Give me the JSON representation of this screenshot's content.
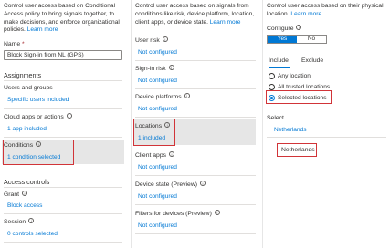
{
  "pane1": {
    "description": "Control user access based on Conditional Access policy to bring signals together, to make decisions, and enforce organizational policies.",
    "learn_more": "Learn more",
    "name_label": "Name",
    "required_mark": "*",
    "name_value": "Block Sign-in from NL (GPS)",
    "assignments_heading": "Assignments",
    "users_label": "Users and groups",
    "users_value": "Specific users included",
    "apps_label": "Cloud apps or actions",
    "apps_value": "1 app included",
    "conditions_label": "Conditions",
    "conditions_value": "1 condition selected",
    "access_heading": "Access controls",
    "grant_label": "Grant",
    "grant_value": "Block access",
    "session_label": "Session",
    "session_value": "0 controls selected"
  },
  "pane2": {
    "description": "Control user access based on signals from conditions like risk, device platform, location, client apps, or device state.",
    "learn_more": "Learn more",
    "items": [
      {
        "label": "User risk",
        "value": "Not configured"
      },
      {
        "label": "Sign-in risk",
        "value": "Not configured"
      },
      {
        "label": "Device platforms",
        "value": "Not configured"
      },
      {
        "label": "Locations",
        "value": "1 included"
      },
      {
        "label": "Client apps",
        "value": "Not configured"
      },
      {
        "label": "Device state (Preview)",
        "value": "Not configured"
      },
      {
        "label": "Filters for devices (Preview)",
        "value": "Not configured"
      }
    ]
  },
  "pane3": {
    "description": "Control user access based on their physical location.",
    "learn_more": "Learn more",
    "configure_label": "Configure",
    "toggle_yes": "Yes",
    "toggle_no": "No",
    "tab_include": "Include",
    "tab_exclude": "Exclude",
    "options": [
      "Any location",
      "All trusted locations",
      "Selected locations"
    ],
    "selected_option": "Selected locations",
    "select_label": "Select",
    "select_value": "Netherlands",
    "selected_item": "Netherlands",
    "more_glyph": "···"
  }
}
